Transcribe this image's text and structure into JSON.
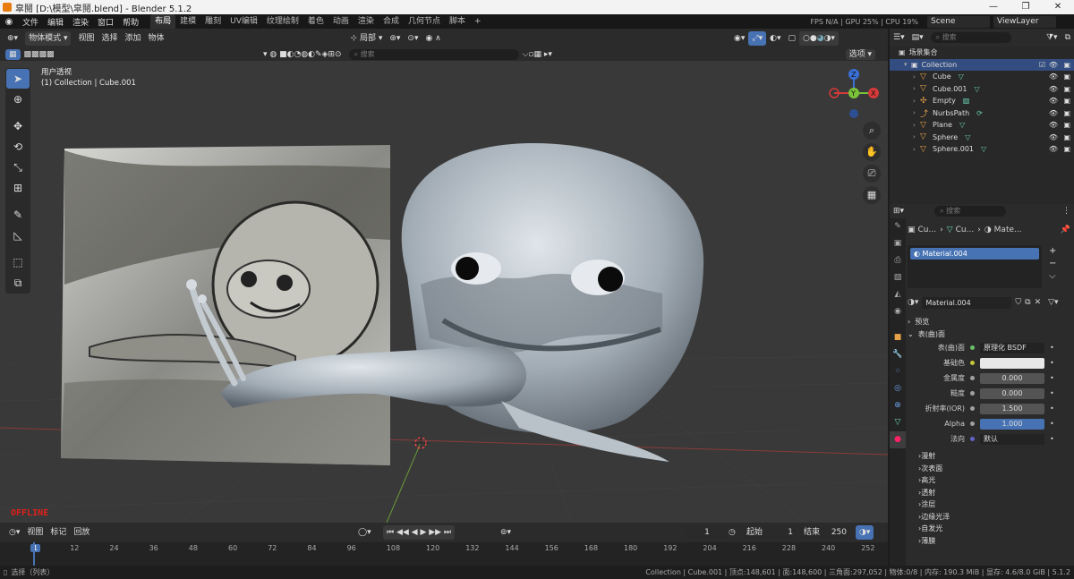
{
  "window": {
    "title": "皐鬩 [D:\\模型\\皐鬩.blend] - Blender 5.1.2",
    "minimize": "—",
    "restore": "❐",
    "close": "✕"
  },
  "topbar": {
    "menus": [
      "文件",
      "编辑",
      "渲染",
      "窗口",
      "帮助"
    ],
    "workspaces": [
      "布局",
      "建模",
      "雕刻",
      "UV编辑",
      "纹理绘制",
      "着色",
      "动画",
      "渲染",
      "合成",
      "几何节点",
      "脚本"
    ],
    "add_ws": "+",
    "scene": "Scene",
    "view_layer": "ViewLayer",
    "stats": "FPS N/A | GPU 25% | CPU 19%"
  },
  "vpheader": {
    "mode": "物体模式",
    "menus": [
      "视图",
      "选择",
      "添加",
      "物体"
    ],
    "orientation": "局部",
    "options": "选项"
  },
  "vptool": {
    "search_placeholder": "搜索"
  },
  "viewport": {
    "view_name": "用户透视",
    "collection_info": "(1) Collection | Cube.001",
    "offline": "OFFLINE"
  },
  "outliner": {
    "search_placeholder": "搜索",
    "root": "场景集合",
    "collection": "Collection",
    "items": [
      {
        "name": "Cube",
        "icon": "mesh-icon"
      },
      {
        "name": "Cube.001",
        "icon": "mesh-icon"
      },
      {
        "name": "Empty",
        "icon": "empty-icon"
      },
      {
        "name": "NurbsPath",
        "icon": "curve-icon"
      },
      {
        "name": "Plane",
        "icon": "mesh-icon"
      },
      {
        "name": "Sphere",
        "icon": "mesh-icon"
      },
      {
        "name": "Sphere.001",
        "icon": "mesh-icon"
      }
    ]
  },
  "props": {
    "search_placeholder": "搜索",
    "breadcrumb": [
      "Cu...",
      "Cu...",
      "Mate..."
    ],
    "slot": "Material.004",
    "material": "Material.004",
    "preview": "预览",
    "surface": "表(曲)面",
    "rows": [
      {
        "label": "表(曲)面",
        "value": "原理化 BSDF",
        "dot": "#6ac26a"
      },
      {
        "label": "基础色",
        "value": "",
        "dot": "#c7c73b"
      },
      {
        "label": "金属度",
        "value": "0.000",
        "dot": "#a0a0a0"
      },
      {
        "label": "糙度",
        "value": "0.000",
        "dot": "#a0a0a0"
      },
      {
        "label": "折射率(IOR)",
        "value": "1.500",
        "dot": "#a0a0a0"
      },
      {
        "label": "Alpha",
        "value": "1.000",
        "dot": "#a0a0a0"
      },
      {
        "label": "法向",
        "value": "默认",
        "dot": "#6363c7"
      }
    ],
    "sections": [
      "漫射",
      "次表面",
      "高光",
      "透射",
      "涂层",
      "边缘光泽",
      "自发光",
      "薄膜"
    ]
  },
  "timeline": {
    "menus": [
      "视图",
      "标记",
      "回放"
    ],
    "current": "1",
    "start_label": "起始",
    "start": "1",
    "end_label": "结束",
    "end": "250",
    "ticks": [
      "1",
      "12",
      "24",
      "36",
      "48",
      "60",
      "72",
      "84",
      "96",
      "108",
      "120",
      "132",
      "144",
      "156",
      "168",
      "180",
      "192",
      "204",
      "216",
      "228",
      "240",
      "252"
    ]
  },
  "status": {
    "left": "选择（列表）",
    "right": "Collection | Cube.001 | 顶点:148,601 | 面:148,600 | 三角面:297,052 | 物体:0/8 | 内存: 190.3 MiB | 显存: 4.6/8.0 GiB | 5.1.2"
  }
}
